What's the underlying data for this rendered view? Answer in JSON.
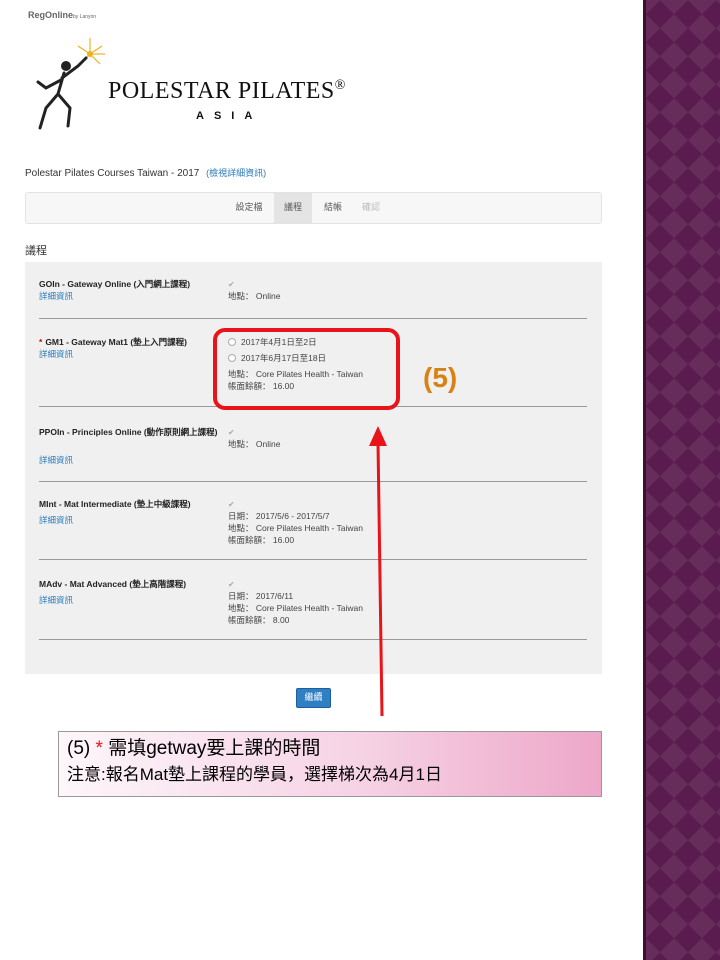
{
  "brand": {
    "name": "RegOnline",
    "suffix": "by Lanyon"
  },
  "logo": {
    "title": "POLESTAR PILATES",
    "mark": "®",
    "sub": "ASIA"
  },
  "event": {
    "name": "Polestar Pilates Courses Taiwan - 2017",
    "details_link": "(檢視詳細資訊)"
  },
  "tabs": [
    {
      "label": "設定檔",
      "state": "normal"
    },
    {
      "label": "議程",
      "state": "active"
    },
    {
      "label": "結帳",
      "state": "normal"
    },
    {
      "label": "確認",
      "state": "disabled"
    }
  ],
  "section_title": "議程",
  "details_label": "詳細資訊",
  "sessions": [
    {
      "name": "GOIn - Gateway Online (入門網上課程)",
      "required": false,
      "lines": [
        "地點： Online"
      ]
    },
    {
      "name": "GM1 - Gateway Mat1 (墊上入門課程)",
      "required": true,
      "required_mark": "*",
      "options": [
        "2017年4月1日至2日",
        "2017年6月17日至18日"
      ],
      "lines": [
        "地點： Core Pilates Health - Taiwan",
        "帳面餘額： 16.00"
      ]
    },
    {
      "name": "PPOIn - Principles Online (動作原則網上課程)",
      "required": false,
      "lines": [
        "地點： Online"
      ]
    },
    {
      "name": "MInt - Mat Intermediate (墊上中級課程)",
      "required": false,
      "lines": [
        "日期： 2017/5/6 - 2017/5/7",
        "地點： Core Pilates Health - Taiwan",
        "帳面餘額： 16.00"
      ]
    },
    {
      "name": "MAdv - Mat Advanced (墊上高階課程)",
      "required": false,
      "lines": [
        "日期： 2017/6/11",
        "地點： Core Pilates Health - Taiwan",
        "帳面餘額： 8.00"
      ]
    }
  ],
  "continue_label": "繼續",
  "annotation": {
    "label": "(5)",
    "note_prefix": "(5)",
    "note_star": "*",
    "note_line1": "需填getway要上課的時間",
    "note_line2": "注意:報名Mat墊上課程的學員，選擇梯次為4月1日"
  },
  "colors": {
    "accent": "#2a7ab9",
    "highlight": "#e8141a",
    "annotation": "#d98213",
    "strip": "#5a1c4e"
  }
}
